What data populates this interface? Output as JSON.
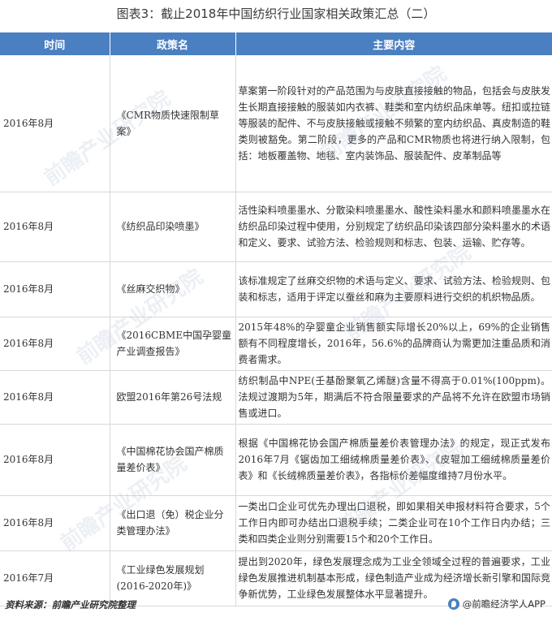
{
  "title": "图表3：截止2018年中国纺织行业国家相关政策汇总（二）",
  "table": {
    "headers": [
      "时间",
      "政策名",
      "主要内容"
    ],
    "rows": [
      {
        "time": "2016年8月",
        "name": "《CMR物质快速限制草案》",
        "content": "草案第一阶段针对的产品范围为与皮肤直接接触的物品，包括会与皮肤发生长期直接接触的服装如内衣裤、鞋类和室内纺织品床单等。纽扣或拉链等服装的配件、不与皮肤接触或接触不频繁的室内纺织品、真皮制造的鞋类则被豁免。第二阶段，更多的产品和CMR物质也将进行纳入限制，包括：地板覆盖物、地毯、室内装饰品、服装配件、皮革制品等"
      },
      {
        "time": "2016年8月",
        "name": "《纺织品印染喷墨》",
        "content": "活性染料喷墨墨水、分散染料喷墨墨水、酸性染料墨水和颜料喷墨墨水在纺织品印染过程中使用，分别规定了纺织品印染该四部分染料墨水的术语和定义、要求、试验方法、检验规则和标志、包装、运输、贮存等。"
      },
      {
        "time": "2016年8月",
        "name": "《丝麻交织物》",
        "content": "该标准规定了丝麻交织物的术语与定义、要求、试验方法、检验规则、包装和标志，适用于评定以蚕丝和麻为主要原料进行交织的机织物品质。"
      },
      {
        "time": "2016年8月",
        "name": "《2016CBME中国孕婴童产业调查报告》",
        "content": "2015年48%的孕婴童企业销售额实际增长20%以上，69%的企业销售额有不同程度增长，2016年，56.6%的品牌商认为需更加注重品质和消费者需求。"
      },
      {
        "time": "2016年8月",
        "name": "欧盟2016年第26号法规",
        "content": "纺织制品中NPE(壬基酚聚氧乙烯醚)含量不得高于0.01%(100ppm)。法规过渡期为5年，期满后不符合限量要求的产品将不允许在欧盟市场销售或进口。"
      },
      {
        "time": "2016年8月",
        "name": "《中国棉花协会国产棉质量差价表》",
        "content": "根据《中国棉花协会国产棉质量差价表管理办法》的规定，现正式发布2016年7月《锯齿加工细绒棉质量差价表》、《皮辊加工细绒棉质量差价表》和《长绒棉质量差价表》，各指标价差幅度维持7月份水平。"
      },
      {
        "time": "2016年8月",
        "name": "《出口退（免）税企业分类管理办法》",
        "content": "一类出口企业可优先办理出口退税，即如果相关申报材料符合要求，5个工作日内即可办结出口退税手续；二类企业可在10个工作日内办结；三类和四类企业则分别需要15个和20个工作日。"
      },
      {
        "time": "2016年7月",
        "name": "《工业绿色发展规划(2016-2020年)》",
        "content": "提出到2020年，绿色发展理念成为工业全领域全过程的普遍要求，工业绿色发展推进机制基本形成，绿色制造产业成为经济增长新引擎和国际竞争新优势，工业绿色发展整体水平显著提升。"
      }
    ]
  },
  "footer": {
    "source": "资料来源：前瞻产业研究院整理",
    "brand": "@前瞻经济学人APP"
  },
  "watermark": "前瞻产业研究院",
  "colors": {
    "header_bg": "#4a7fc1",
    "header_text": "#ffffff",
    "border": "#d8d8d8"
  }
}
